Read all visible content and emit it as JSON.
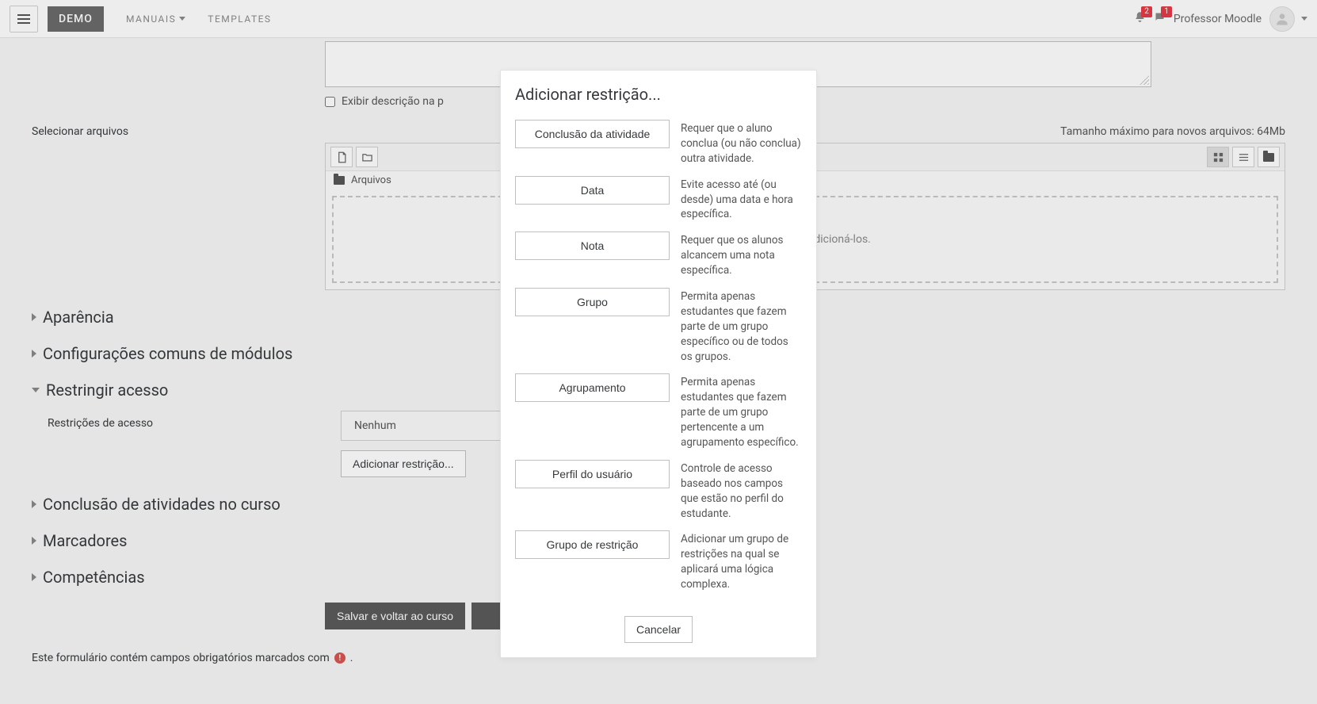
{
  "navbar": {
    "brand": "DEMO",
    "links": [
      {
        "label": "MANUAIS",
        "has_caret": true
      },
      {
        "label": "TEMPLATES",
        "has_caret": false
      }
    ],
    "notif_count": "2",
    "msg_count": "1",
    "user_name": "Professor Moodle"
  },
  "desc_checkbox_label": "Exibir descrição na p",
  "files": {
    "section_label": "Selecionar arquivos",
    "maxsize": "Tamanho máximo para novos arquivos: 64Mb",
    "path_label": "Arquivos",
    "drop_hint": "vos aqui para adicioná-los."
  },
  "sections": {
    "appearance": "Aparência",
    "common": "Configurações comuns de módulos",
    "restrict": "Restringir acesso",
    "completion": "Conclusão de atividades no curso",
    "tags": "Marcadores",
    "competencies": "Competências"
  },
  "restrict_block": {
    "field_label": "Restrições de acesso",
    "none_label": "Nenhum",
    "add_button": "Adicionar restrição..."
  },
  "buttons": {
    "save_return": "Salvar e voltar ao curso"
  },
  "form_note": "Este formulário contém campos obrigatórios marcados com",
  "form_note_end": ".",
  "modal": {
    "title": "Adicionar restrição...",
    "restrictions": [
      {
        "btn": "Conclusão da atividade",
        "desc": "Requer que o aluno conclua (ou não conclua) outra atividade."
      },
      {
        "btn": "Data",
        "desc": "Evite acesso até (ou desde) uma data e hora específica."
      },
      {
        "btn": "Nota",
        "desc": "Requer que os alunos alcancem uma nota específica."
      },
      {
        "btn": "Grupo",
        "desc": "Permita apenas estudantes que fazem parte de um grupo específico ou de todos os grupos."
      },
      {
        "btn": "Agrupamento",
        "desc": "Permita apenas estudantes que fazem parte de um grupo pertencente a um agrupamento específico."
      },
      {
        "btn": "Perfil do usuário",
        "desc": "Controle de acesso baseado nos campos que estão no perfil do estudante."
      },
      {
        "btn": "Grupo de restrição",
        "desc": "Adicionar um grupo de restrições na qual se aplicará uma lógica complexa."
      }
    ],
    "cancel": "Cancelar"
  }
}
